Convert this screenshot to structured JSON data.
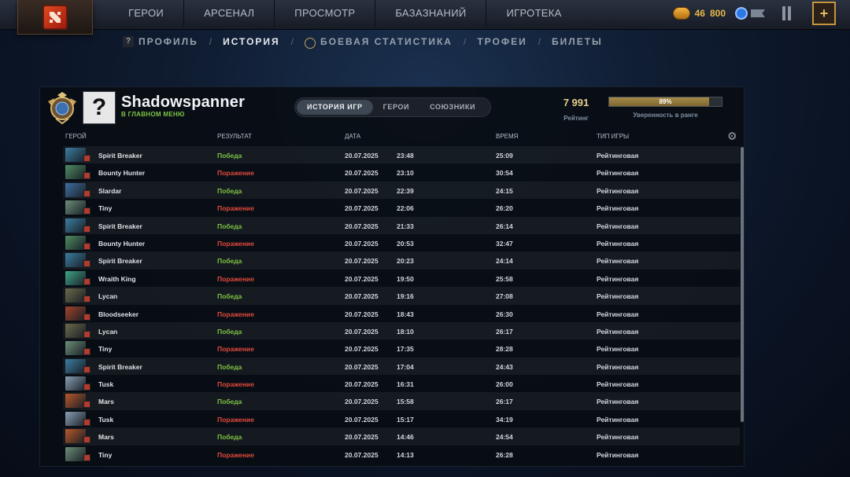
{
  "nav": [
    "ГЕРОИ",
    "АРСЕНАЛ",
    "ПРОСМОТР",
    "БАЗАЗНАНИЙ",
    "ИГРОТЕКА"
  ],
  "currency": {
    "a": "46",
    "b": "800"
  },
  "subnav": {
    "profile": "ПРОФИЛЬ",
    "history": "ИСТОРИЯ",
    "stats": "БОЕВАЯ СТАТИСТИКА",
    "trophies": "ТРОФЕИ",
    "tickets": "БИЛЕТЫ"
  },
  "player": {
    "avatar": "?",
    "name": "Shadowspanner",
    "status": "В ГЛАВНОМ МЕНЮ"
  },
  "tabs": [
    "ИСТОРИЯ ИГР",
    "ГЕРОИ",
    "СОЮЗНИКИ"
  ],
  "rating": {
    "value": "7 991",
    "label": "Рейтинг"
  },
  "confidence": {
    "percent": "89%",
    "fill": 0.89,
    "label": "Уверенность в ранге"
  },
  "columns": {
    "hero": "ГЕРОЙ",
    "result": "РЕЗУЛЬТАТ",
    "date": "ДАТА",
    "time": "ВРЕМЯ",
    "mode": "ТИП ИГРЫ"
  },
  "matches": [
    {
      "hero": "Spirit Breaker",
      "result": "Победа",
      "win": true,
      "date": "20.07.2025",
      "time": "23:48",
      "duration": "25:09",
      "mode": "Рейтинговая",
      "color": "#3b7ea1"
    },
    {
      "hero": "Bounty Hunter",
      "result": "Поражение",
      "win": false,
      "date": "20.07.2025",
      "time": "23:10",
      "duration": "30:54",
      "mode": "Рейтинговая",
      "color": "#4e8c62"
    },
    {
      "hero": "Slardar",
      "result": "Победа",
      "win": true,
      "date": "20.07.2025",
      "time": "22:39",
      "duration": "24:15",
      "mode": "Рейтинговая",
      "color": "#3f6fa3"
    },
    {
      "hero": "Tiny",
      "result": "Поражение",
      "win": false,
      "date": "20.07.2025",
      "time": "22:06",
      "duration": "26:20",
      "mode": "Рейтинговая",
      "color": "#6d8f78"
    },
    {
      "hero": "Spirit Breaker",
      "result": "Победа",
      "win": true,
      "date": "20.07.2025",
      "time": "21:33",
      "duration": "26:14",
      "mode": "Рейтинговая",
      "color": "#3b7ea1"
    },
    {
      "hero": "Bounty Hunter",
      "result": "Поражение",
      "win": false,
      "date": "20.07.2025",
      "time": "20:53",
      "duration": "32:47",
      "mode": "Рейтинговая",
      "color": "#4e8c62"
    },
    {
      "hero": "Spirit Breaker",
      "result": "Победа",
      "win": true,
      "date": "20.07.2025",
      "time": "20:23",
      "duration": "24:14",
      "mode": "Рейтинговая",
      "color": "#3b7ea1"
    },
    {
      "hero": "Wraith King",
      "result": "Поражение",
      "win": false,
      "date": "20.07.2025",
      "time": "19:50",
      "duration": "25:58",
      "mode": "Рейтинговая",
      "color": "#3fa58a"
    },
    {
      "hero": "Lycan",
      "result": "Победа",
      "win": true,
      "date": "20.07.2025",
      "time": "19:16",
      "duration": "27:08",
      "mode": "Рейтинговая",
      "color": "#6c6a4a"
    },
    {
      "hero": "Bloodseeker",
      "result": "Поражение",
      "win": false,
      "date": "20.07.2025",
      "time": "18:43",
      "duration": "26:30",
      "mode": "Рейтинговая",
      "color": "#a3432b"
    },
    {
      "hero": "Lycan",
      "result": "Победа",
      "win": true,
      "date": "20.07.2025",
      "time": "18:10",
      "duration": "26:17",
      "mode": "Рейтинговая",
      "color": "#6c6a4a"
    },
    {
      "hero": "Tiny",
      "result": "Поражение",
      "win": false,
      "date": "20.07.2025",
      "time": "17:35",
      "duration": "28:28",
      "mode": "Рейтинговая",
      "color": "#6d8f78"
    },
    {
      "hero": "Spirit Breaker",
      "result": "Победа",
      "win": true,
      "date": "20.07.2025",
      "time": "17:04",
      "duration": "24:43",
      "mode": "Рейтинговая",
      "color": "#3b7ea1"
    },
    {
      "hero": "Tusk",
      "result": "Поражение",
      "win": false,
      "date": "20.07.2025",
      "time": "16:31",
      "duration": "26:00",
      "mode": "Рейтинговая",
      "color": "#8aa0b4"
    },
    {
      "hero": "Mars",
      "result": "Победа",
      "win": true,
      "date": "20.07.2025",
      "time": "15:58",
      "duration": "26:17",
      "mode": "Рейтинговая",
      "color": "#b8572a"
    },
    {
      "hero": "Tusk",
      "result": "Поражение",
      "win": false,
      "date": "20.07.2025",
      "time": "15:17",
      "duration": "34:19",
      "mode": "Рейтинговая",
      "color": "#8aa0b4"
    },
    {
      "hero": "Mars",
      "result": "Победа",
      "win": true,
      "date": "20.07.2025",
      "time": "14:46",
      "duration": "24:54",
      "mode": "Рейтинговая",
      "color": "#b8572a"
    },
    {
      "hero": "Tiny",
      "result": "Поражение",
      "win": false,
      "date": "20.07.2025",
      "time": "14:13",
      "duration": "26:28",
      "mode": "Рейтинговая",
      "color": "#6d8f78"
    }
  ]
}
